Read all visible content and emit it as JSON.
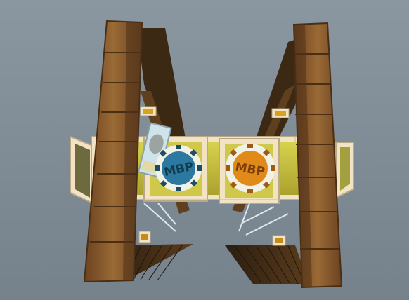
{
  "scene": {
    "type": "3d-game-level-view",
    "background_color": "#7d8a95",
    "pillar_color": "#8a5a2b",
    "platform_color": "#c9c23a",
    "trim_color": "#f1e3c4"
  },
  "emblems": [
    {
      "name": "blue-mbp-emblem",
      "text": "MBP",
      "color": "#2b78a0",
      "ring": "#f1f1e6"
    },
    {
      "name": "orange-mbp-emblem",
      "text": "MBP",
      "color": "#e08a1a",
      "ring": "#f1f1e6"
    }
  ],
  "objects": {
    "poster": "tilted-poster",
    "coin_blocks": 4,
    "pillars": 2,
    "side_rails": 2
  }
}
